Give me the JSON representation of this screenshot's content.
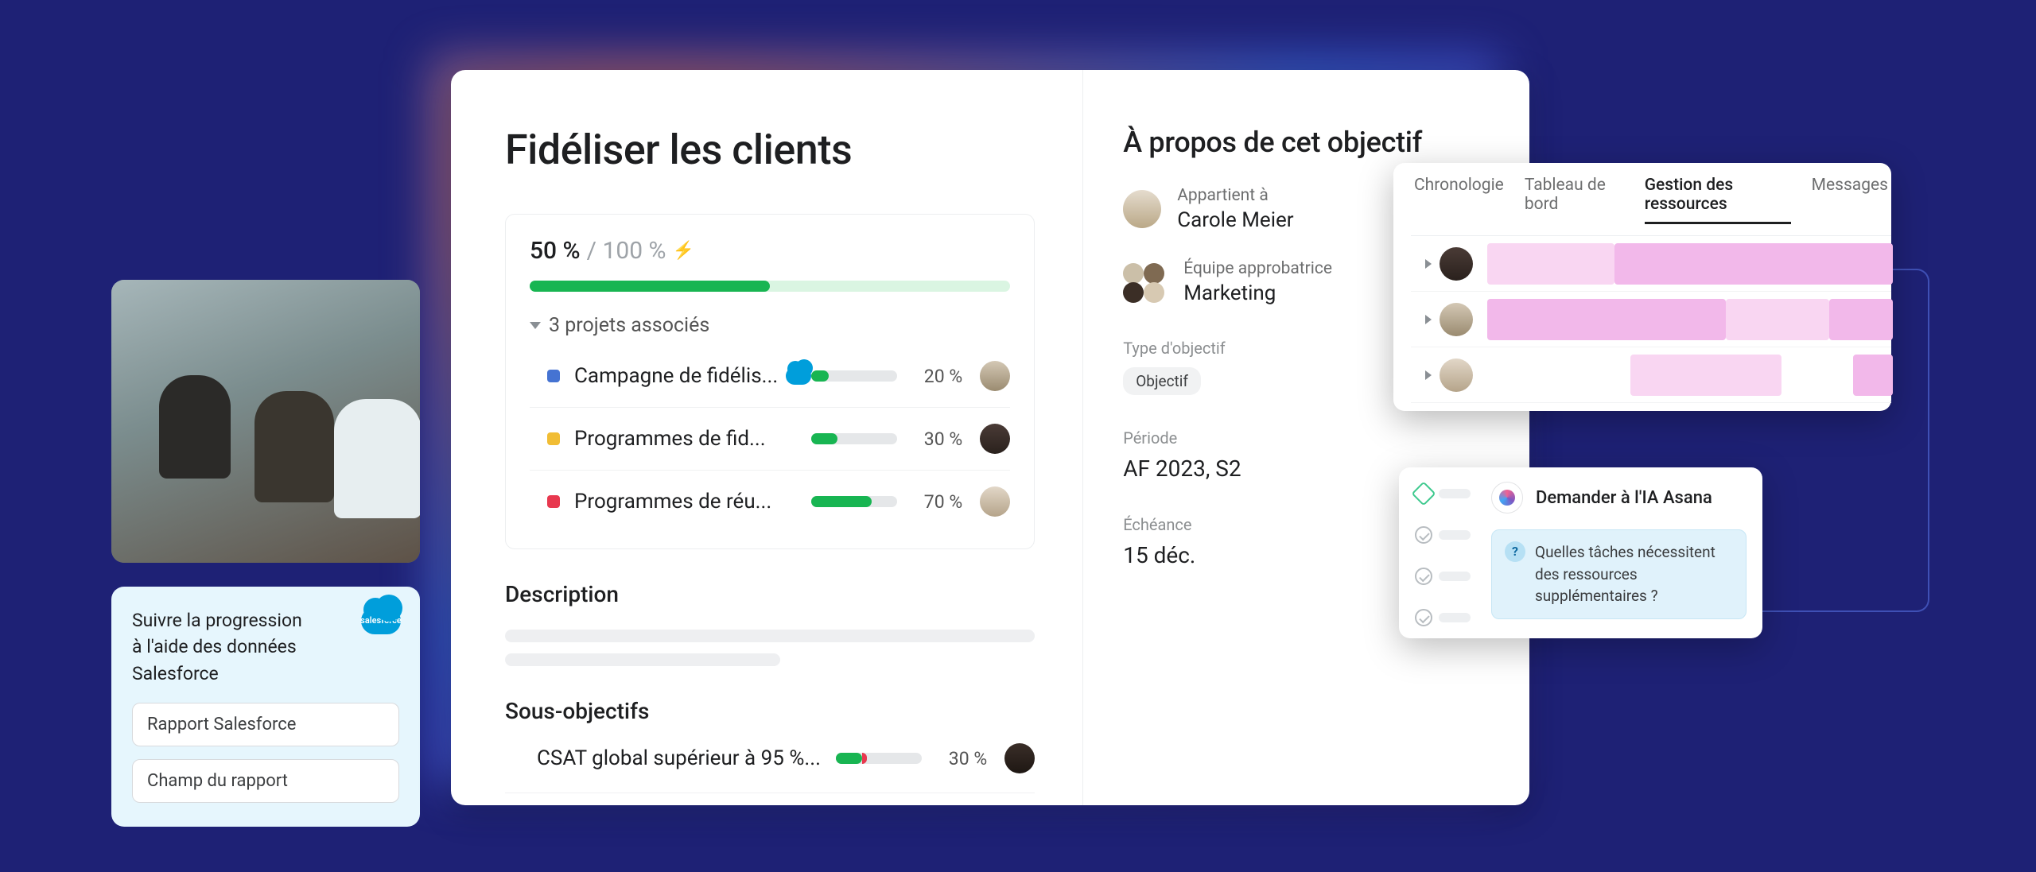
{
  "goal": {
    "title": "Fidéliser les clients",
    "progress_current": "50 %",
    "progress_sep": " / ",
    "progress_total": "100 %",
    "progress_pct": 50,
    "projects_header": "3 projets associés",
    "projects": [
      {
        "name": "Campagne de fidélis...",
        "color": "#4573d2",
        "pct_label": "20 %",
        "pct": 20,
        "has_cloud": true
      },
      {
        "name": "Programmes de fid...",
        "color": "#f1bd34",
        "pct_label": "30 %",
        "pct": 30,
        "has_cloud": false
      },
      {
        "name": "Programmes de réu...",
        "color": "#e8384f",
        "pct_label": "70 %",
        "pct": 70,
        "has_cloud": false
      }
    ],
    "description_heading": "Description",
    "subgoals_heading": "Sous-objectifs",
    "subgoal": {
      "name": "CSAT global supérieur à 95 %...",
      "pct_label": "30 %",
      "pct": 30,
      "red": true
    }
  },
  "about": {
    "heading": "À propos de cet objectif",
    "owner_label": "Appartient à",
    "owner_name": "Carole Meier",
    "approver_label": "Équipe approbatrice",
    "approver_name": "Marketing",
    "type_label": "Type d'objectif",
    "type_value": "Objectif",
    "period_label": "Période",
    "period_value": "AF 2023, S2",
    "due_label": "Échéance",
    "due_value": "15 déc."
  },
  "salesforce": {
    "title": "Suivre la progression à l'aide des données Salesforce",
    "cloud_text": "salesforce",
    "input1": "Rapport Salesforce",
    "input2": "Champ du rapport"
  },
  "resources": {
    "tabs": [
      "Chronologie",
      "Tableau de bord",
      "Gestion des ressources",
      "Messages"
    ],
    "active_tab_index": 2
  },
  "ai": {
    "title": "Demander à l'IA Asana",
    "q_mark": "?",
    "prompt": "Quelles tâches nécessitent des ressources supplémentaires ?"
  },
  "colors": {
    "blue": "#4573d2",
    "yellow": "#f1bd34",
    "red": "#e8384f",
    "green": "#18b552"
  }
}
